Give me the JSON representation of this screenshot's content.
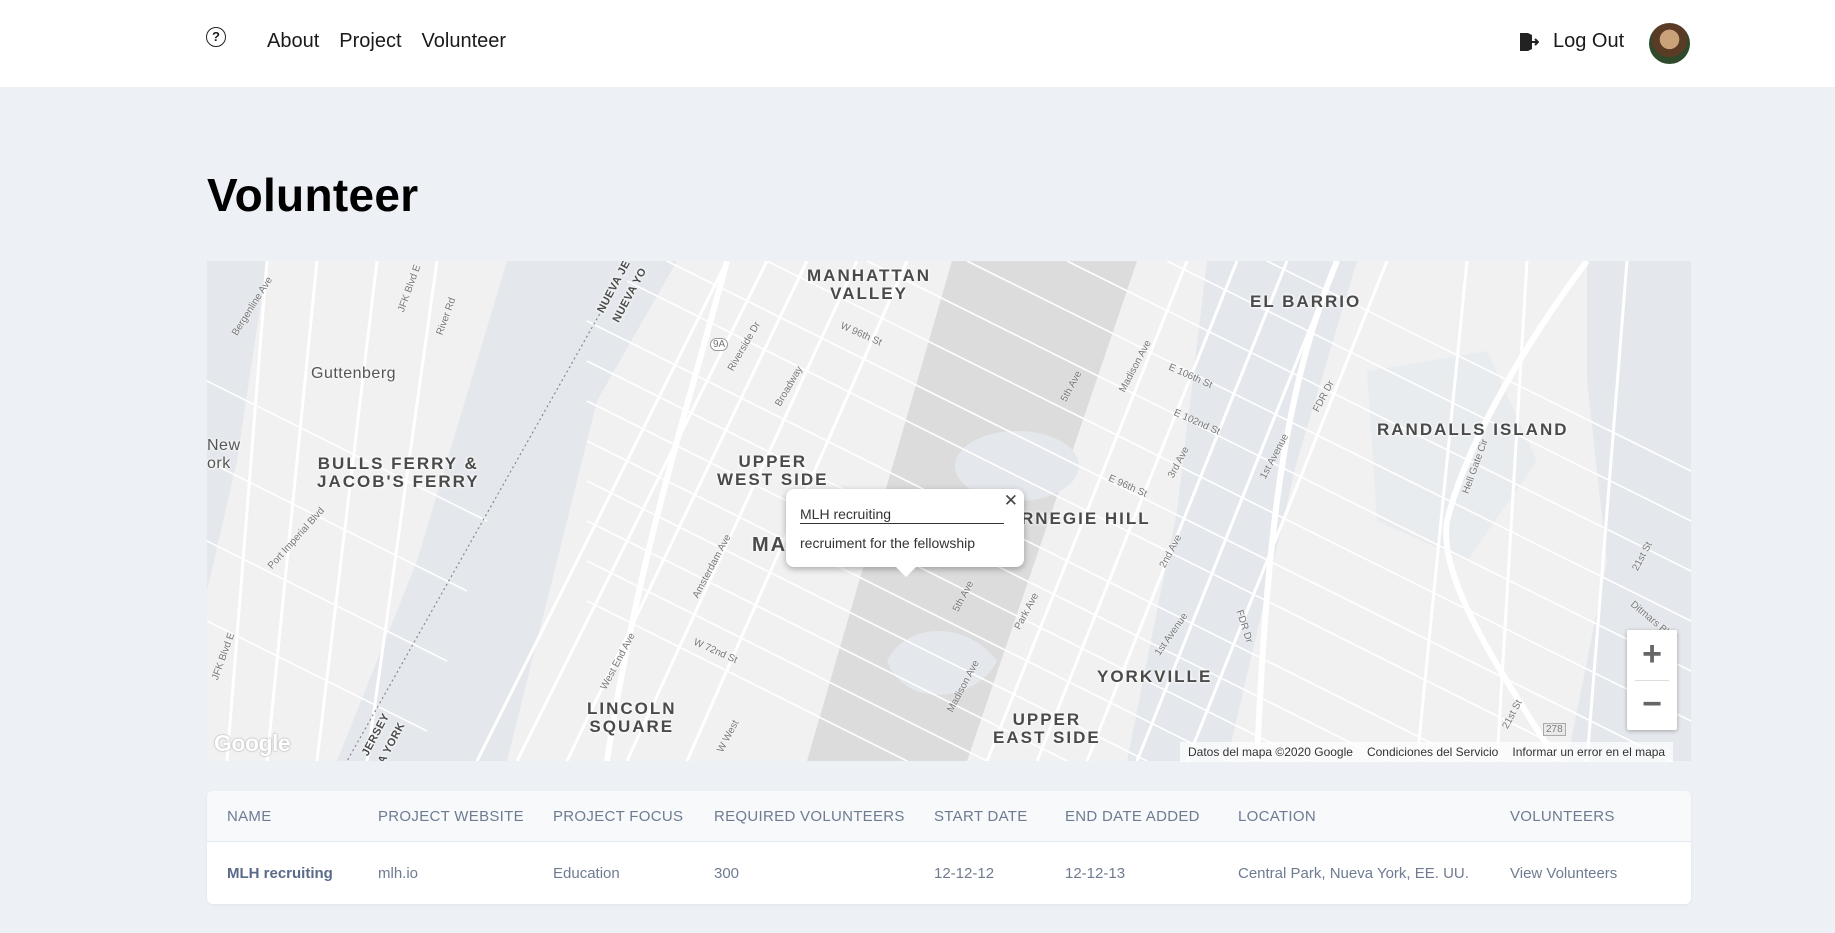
{
  "nav": {
    "help_icon": "question-circle-icon",
    "links": [
      "About",
      "Project",
      "Volunteer"
    ],
    "logout_label": "Log Out",
    "logout_icon": "logout-door-icon"
  },
  "page": {
    "title": "Volunteer"
  },
  "map": {
    "labels": {
      "manhattan_valley_1": "MANHATTAN",
      "manhattan_valley_2": "VALLEY",
      "el_barrio": "EL BARRIO",
      "guttenberg": "Guttenberg",
      "randalls_island": "RANDALLS ISLAND",
      "new_york_1": "New",
      "new_york_2": "ork",
      "bulls_ferry_1": "BULLS FERRY &",
      "bulls_ferry_2": "JACOB'S FERRY",
      "upper_west_1": "UPPER",
      "upper_west_2": "WEST SIDE",
      "carnegie_hill": "RNEGIE HILL",
      "manhattan_partial": "MA",
      "yorkville": "YORKVILLE",
      "lincoln_1": "LINCOLN",
      "lincoln_2": "SQUARE",
      "upper_east_1": "UPPER",
      "upper_east_2": "EAST SIDE",
      "nueva_jersey_top_1": "NUEVA JE",
      "nueva_jersey_top_2": "NUEVA YO",
      "nueva_jersey_bottom_1": "JERSEY",
      "nueva_jersey_bottom_2": "A YORK"
    },
    "streets": {
      "bergenline": "Bergenline Ave",
      "jfk_top": "JFK Blvd E",
      "river_rd": "River Rd",
      "w96": "W 96th St",
      "riverside": "Riverside Dr",
      "broadway": "Broadway",
      "fifth_ave_top": "5th Ave",
      "madison_top": "Madison Ave",
      "e106": "E 106th St",
      "e102": "E 102nd St",
      "fdr_top": "FDR Dr",
      "first_ave_top": "1st Avenue",
      "hell_gate": "Hell Gate Cir",
      "third_ave": "3rd Ave",
      "e96": "E 96th St",
      "port_imperial": "Port Imperial Blvd",
      "amsterdam": "Amsterdam Ave",
      "second_ave": "2nd Ave",
      "fdr_mid": "FDR Dr",
      "first_ave_mid": "1st Avenue",
      "fifth_ave_mid": "5th Ave",
      "park_ave": "Park Ave",
      "w72": "W 72nd St",
      "west_end": "West End Ave",
      "madison_bottom": "Madison Ave",
      "jfk_bottom": "JFK Blvd E",
      "twenty_first": "21st St",
      "twenty_first_2": "21st St",
      "ditmars": "Ditmars Blvd",
      "route_9a": "9A",
      "route_278": "278",
      "west_partial": "W West"
    },
    "popup": {
      "title": "MLH recruiting",
      "description": "recruiment for the fellowship",
      "close_icon": "close-icon",
      "close_glyph": "✕"
    },
    "zoom": {
      "in": "+",
      "out": "−"
    },
    "google_logo": "Google",
    "attribution": {
      "data": "Datos del mapa ©2020 Google",
      "terms": "Condiciones del Servicio",
      "report": "Informar un error en el mapa"
    }
  },
  "table": {
    "headers": [
      "Name",
      "Project Website",
      "Project Focus",
      "Required Volunteers",
      "Start Date",
      "End Date Added",
      "Location",
      "Volunteers"
    ],
    "rows": [
      {
        "name": "MLH recruiting",
        "website": "mlh.io",
        "focus": "Education",
        "required": "300",
        "start": "12-12-12",
        "end": "12-12-13",
        "location": "Central Park, Nueva York, EE. UU.",
        "volunteers": "View Volunteers"
      }
    ]
  }
}
